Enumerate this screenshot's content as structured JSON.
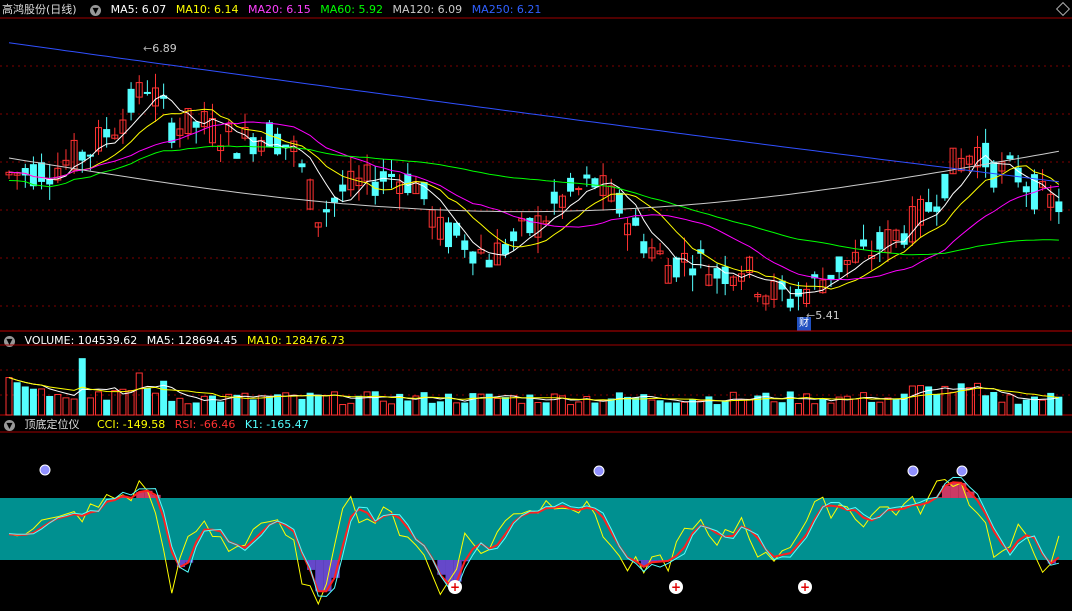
{
  "price_panel": {
    "title": "高鸿股份(日线)",
    "ma5": "MA5: 6.07",
    "ma10": "MA10: 6.14",
    "ma20": "MA20: 6.15",
    "ma60": "MA60: 5.92",
    "ma120": "MA120: 6.09",
    "ma250": "MA250: 6.21",
    "high_label": "6.89",
    "low_label": "5.41",
    "event_tag": "财"
  },
  "volume_panel": {
    "volume": "VOLUME: 104539.62",
    "ma5": "MA5: 128694.45",
    "ma10": "MA10: 128476.73"
  },
  "indicator_panel": {
    "title": "顶底定位仪",
    "cci": "CCI: -149.58",
    "rsi": "RSI: -66.46",
    "k1": "K1: -165.47"
  },
  "colors": {
    "up": "#ff3232",
    "down": "#54ffff",
    "ma5": "#ffffff",
    "ma10": "#ffff00",
    "ma20": "#ff00ff",
    "ma60": "#00ff00",
    "ma120": "#cccccc",
    "ma250": "#3050ff",
    "band": "#009090"
  },
  "chart_data": [
    {
      "type": "candlestick",
      "title": "高鸿股份(日线)",
      "ylim": [
        5.3,
        7.2
      ],
      "max_value": 6.89,
      "min_value": 5.41,
      "series": [
        {
          "name": "MA5",
          "last": 6.07
        },
        {
          "name": "MA10",
          "last": 6.14
        },
        {
          "name": "MA20",
          "last": 6.15
        },
        {
          "name": "MA60",
          "last": 5.92
        },
        {
          "name": "MA120",
          "last": 6.09
        },
        {
          "name": "MA250",
          "last": 6.21
        }
      ]
    },
    {
      "type": "bar",
      "title": "VOLUME",
      "series": [
        {
          "name": "VOLUME",
          "last": 104539.62
        },
        {
          "name": "MA5",
          "last": 128694.45
        },
        {
          "name": "MA10",
          "last": 128476.73
        }
      ]
    },
    {
      "type": "line",
      "title": "顶底定位仪",
      "series": [
        {
          "name": "CCI",
          "last": -149.58
        },
        {
          "name": "RSI",
          "last": -66.46
        },
        {
          "name": "K1",
          "last": -165.47
        }
      ]
    }
  ]
}
